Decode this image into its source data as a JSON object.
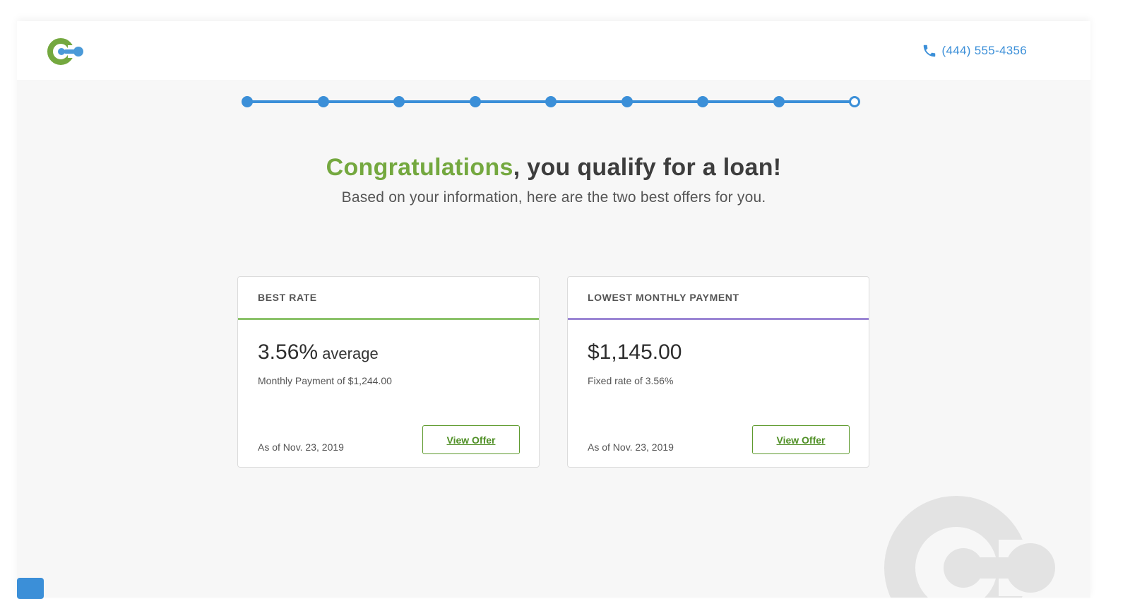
{
  "header": {
    "logo_icon": "cogo-logo-icon",
    "phone_icon": "phone-icon",
    "phone": "(444) 555-4356"
  },
  "progress": {
    "total_steps": 9,
    "completed_steps": 8,
    "current_step": 9
  },
  "hero": {
    "headline_highlight": "Congratulations",
    "headline_rest": ", you qualify for a loan!",
    "subtitle": "Based on your information, here are the two best offers for you."
  },
  "offers": [
    {
      "title": "BEST RATE",
      "value": "3.56%",
      "value_suffix": " average",
      "detail": "Monthly Payment of $1,244.00",
      "as_of": "As of Nov. 23, 2019",
      "button": "View Offer",
      "accent_color": "#8bc26a"
    },
    {
      "title": "LOWEST MONTHLY PAYMENT",
      "value": "$1,145.00",
      "value_suffix": "",
      "detail": "Fixed rate of 3.56%",
      "as_of": "As of Nov. 23, 2019",
      "button": "View Offer",
      "accent_color": "#9b86d4"
    }
  ],
  "colors": {
    "brand_blue": "#3b8fd8",
    "brand_green": "#74a83f",
    "button_green": "#5e9a2e"
  },
  "footer": {
    "brand_icon": "app-brand-icon"
  }
}
